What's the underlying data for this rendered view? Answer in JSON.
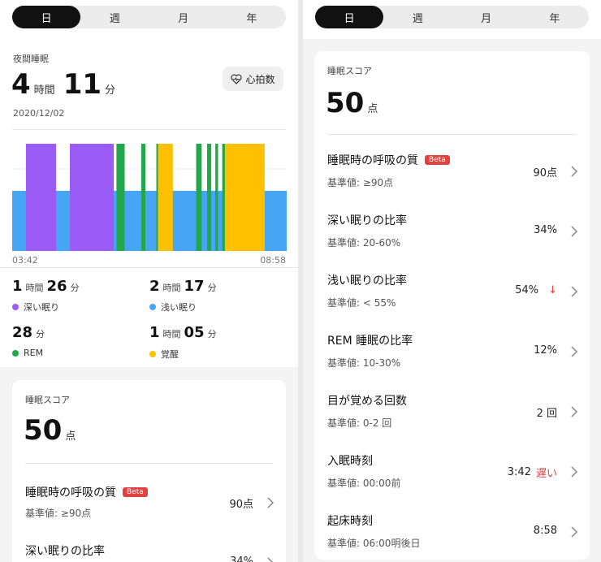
{
  "tabs": [
    "日",
    "週",
    "月",
    "年"
  ],
  "left": {
    "night_label": "夜間睡眠",
    "total_hours": "4",
    "hours_unit": "時間",
    "total_minutes": "11",
    "minutes_unit": "分",
    "date": "2020/12/02",
    "heart_button": "心拍数",
    "chart_start": "03:42",
    "chart_end": "08:58",
    "legend": [
      {
        "h": "1",
        "hu": "時間",
        "m": "26",
        "mu": "分",
        "label": "深い眠り",
        "color": "#9b5cf5"
      },
      {
        "h": "2",
        "hu": "時間",
        "m": "17",
        "mu": "分",
        "label": "浅い眠り",
        "color": "#46a6f5"
      },
      {
        "h": "",
        "hu": "",
        "m": "28",
        "mu": "分",
        "label": "REM",
        "color": "#22a84a"
      },
      {
        "h": "1",
        "hu": "時間",
        "m": "05",
        "mu": "分",
        "label": "覚醒",
        "color": "#ffc000"
      }
    ],
    "score_label": "睡眠スコア",
    "score": "50",
    "score_unit": "点"
  },
  "colors": {
    "deep": "#9b5cf5",
    "light": "#46a6f5",
    "rem": "#22a84a",
    "awake": "#ffc000",
    "warn": "#e0433f"
  },
  "chart_data": {
    "type": "area",
    "x_labels": [
      "03:42",
      "08:58"
    ],
    "segments": [
      {
        "stage": "light",
        "start": 0.0,
        "end": 1.0
      },
      {
        "stage": "deep",
        "start": 0.05,
        "end": 0.16
      },
      {
        "stage": "deep",
        "start": 0.21,
        "end": 0.37
      },
      {
        "stage": "rem",
        "start": 0.38,
        "end": 0.41
      },
      {
        "stage": "rem",
        "start": 0.47,
        "end": 0.485
      },
      {
        "stage": "awake",
        "start": 0.525,
        "end": 0.585
      },
      {
        "stage": "rem",
        "start": 0.525,
        "end": 0.53
      },
      {
        "stage": "rem",
        "start": 0.67,
        "end": 0.69
      },
      {
        "stage": "rem",
        "start": 0.71,
        "end": 0.725
      },
      {
        "stage": "rem",
        "start": 0.74,
        "end": 0.75
      },
      {
        "stage": "rem",
        "start": 0.765,
        "end": 0.775
      },
      {
        "stage": "awake",
        "start": 0.775,
        "end": 0.92
      }
    ]
  },
  "right": {
    "score_label": "睡眠スコア",
    "score": "50",
    "score_unit": "点",
    "rows": [
      {
        "title": "睡眠時の呼吸の質",
        "beta": "Beta",
        "std": "基準値: ≥90点",
        "value": "90点",
        "extra": ""
      },
      {
        "title": "深い眠りの比率",
        "beta": "",
        "std": "基準値: 20-60%",
        "value": "34%",
        "extra": ""
      },
      {
        "title": "浅い眠りの比率",
        "beta": "",
        "std": "基準値: < 55%",
        "value": "54%",
        "extra": "↓"
      },
      {
        "title": "REM 睡眠の比率",
        "beta": "",
        "std": "基準値: 10-30%",
        "value": "12%",
        "extra": ""
      },
      {
        "title": "目が覚める回数",
        "beta": "",
        "std": "基準値: 0-2 回",
        "value": "2 回",
        "extra": ""
      },
      {
        "title": "入眠時刻",
        "beta": "",
        "std": "基準値: 00:00前",
        "value": "3:42",
        "extra": "遅い"
      },
      {
        "title": "起床時刻",
        "beta": "",
        "std": "基準値: 06:00明後日",
        "value": "8:58",
        "extra": ""
      }
    ]
  },
  "left_rows": [
    {
      "title": "睡眠時の呼吸の質",
      "beta": "Beta",
      "std": "基準値: ≥90点",
      "value": "90点"
    },
    {
      "title": "深い眠りの比率",
      "beta": "",
      "std": "",
      "value": "34%"
    }
  ]
}
